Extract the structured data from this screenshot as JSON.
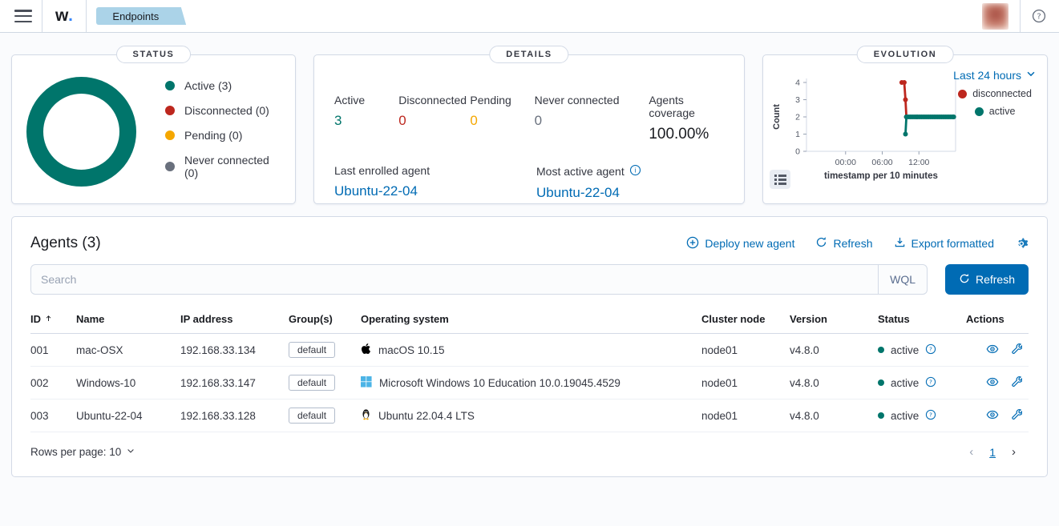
{
  "header": {
    "logo_text": "w",
    "logo_dot": ".",
    "tab_label": "Endpoints"
  },
  "status_card": {
    "title": "STATUS",
    "donut_color": "#00756b",
    "legend": [
      {
        "label": "Active (3)",
        "color": "#00756b"
      },
      {
        "label": "Disconnected (0)",
        "color": "#bd271e"
      },
      {
        "label": "Pending (0)",
        "color": "#f5a700"
      },
      {
        "label": "Never connected (0)",
        "color": "#69707d"
      }
    ]
  },
  "details_card": {
    "title": "DETAILS",
    "stats": [
      {
        "label": "Active",
        "value": "3",
        "color": "#00756b"
      },
      {
        "label": "Disconnected",
        "value": "0",
        "color": "#bd271e"
      },
      {
        "label": "Pending",
        "value": "0",
        "color": "#f5a700"
      },
      {
        "label": "Never connected",
        "value": "0",
        "color": "#69707d"
      },
      {
        "label": "Agents coverage",
        "value": "100.00%",
        "color": "#1a1c21"
      }
    ],
    "last_enrolled_label": "Last enrolled agent",
    "last_enrolled_value": "Ubuntu-22-04",
    "most_active_label": "Most active agent",
    "most_active_value": "Ubuntu-22-04"
  },
  "evolution_card": {
    "title": "EVOLUTION",
    "time_range_label": "Last 24 hours",
    "legend": [
      {
        "label": "disconnected",
        "color": "#bd271e"
      },
      {
        "label": "active",
        "color": "#00756b"
      }
    ],
    "chart_data": {
      "type": "line",
      "xlabel": "timestamp per 10 minutes",
      "ylabel": "Count",
      "x_unit": "hours from midnight, last-24h window",
      "xlim": [
        -6.4,
        18.0
      ],
      "ylim": [
        0,
        4
      ],
      "x_ticks": [
        {
          "v": 0,
          "label": "00:00"
        },
        {
          "v": 6,
          "label": "06:00"
        },
        {
          "v": 12,
          "label": "12:00"
        }
      ],
      "y_ticks": [
        0,
        1,
        2,
        3,
        4
      ],
      "series": [
        {
          "name": "disconnected",
          "color": "#bd271e",
          "points": [
            [
              9.2,
              4
            ],
            [
              9.6,
              4
            ],
            [
              9.8,
              3
            ],
            [
              9.95,
              2
            ]
          ]
        },
        {
          "name": "active",
          "color": "#00756b",
          "points": [
            [
              9.8,
              1
            ],
            [
              9.95,
              2
            ],
            [
              10.3,
              2
            ],
            [
              10.6,
              2
            ],
            [
              10.9,
              2
            ],
            [
              11.2,
              2
            ],
            [
              11.5,
              2
            ],
            [
              11.8,
              2
            ],
            [
              12.1,
              2
            ],
            [
              12.4,
              2
            ],
            [
              12.7,
              2
            ],
            [
              13.0,
              2
            ],
            [
              13.3,
              2
            ],
            [
              13.6,
              2
            ],
            [
              13.9,
              2
            ],
            [
              14.2,
              2
            ],
            [
              14.5,
              2
            ],
            [
              14.8,
              2
            ],
            [
              15.1,
              2
            ],
            [
              15.4,
              2
            ],
            [
              15.7,
              2
            ],
            [
              16.0,
              2
            ],
            [
              16.3,
              2
            ],
            [
              16.6,
              2
            ],
            [
              16.9,
              2
            ],
            [
              17.2,
              2
            ],
            [
              17.5,
              2
            ],
            [
              17.7,
              2
            ]
          ]
        }
      ],
      "legend_position": "right",
      "grid": false
    }
  },
  "agents_panel": {
    "title": "Agents (3)",
    "actions": [
      {
        "label": "Deploy new agent"
      },
      {
        "label": "Refresh"
      },
      {
        "label": "Export formatted"
      }
    ],
    "search_placeholder": "Search",
    "query_language_label": "WQL",
    "refresh_button_label": "Refresh",
    "table": {
      "columns": [
        "ID",
        "Name",
        "IP address",
        "Group(s)",
        "Operating system",
        "Cluster node",
        "Version",
        "Status",
        "Actions"
      ],
      "rows": [
        {
          "id": "001",
          "name": "mac-OSX",
          "ip": "192.168.33.134",
          "group": "default",
          "os": "macOS 10.15",
          "os_icon": "apple-icon",
          "cluster": "node01",
          "version": "v4.8.0",
          "status": "active",
          "status_color": "#00756b"
        },
        {
          "id": "002",
          "name": "Windows-10",
          "ip": "192.168.33.147",
          "group": "default",
          "os": "Microsoft Windows 10 Education 10.0.19045.4529",
          "os_icon": "windows-icon",
          "cluster": "node01",
          "version": "v4.8.0",
          "status": "active",
          "status_color": "#00756b"
        },
        {
          "id": "003",
          "name": "Ubuntu-22-04",
          "ip": "192.168.33.128",
          "group": "default",
          "os": "Ubuntu 22.04.4 LTS",
          "os_icon": "linux-icon",
          "cluster": "node01",
          "version": "v4.8.0",
          "status": "active",
          "status_color": "#00756b"
        }
      ]
    },
    "footer": {
      "rows_per_page_label": "Rows per page: 10",
      "page": "1"
    }
  },
  "colors": {
    "primary": "#006bb4",
    "teal": "#00756b",
    "danger": "#bd271e",
    "warning": "#f5a700",
    "subdued": "#69707d",
    "border": "#d3dae6",
    "tab_bg": "#abd3e8"
  }
}
